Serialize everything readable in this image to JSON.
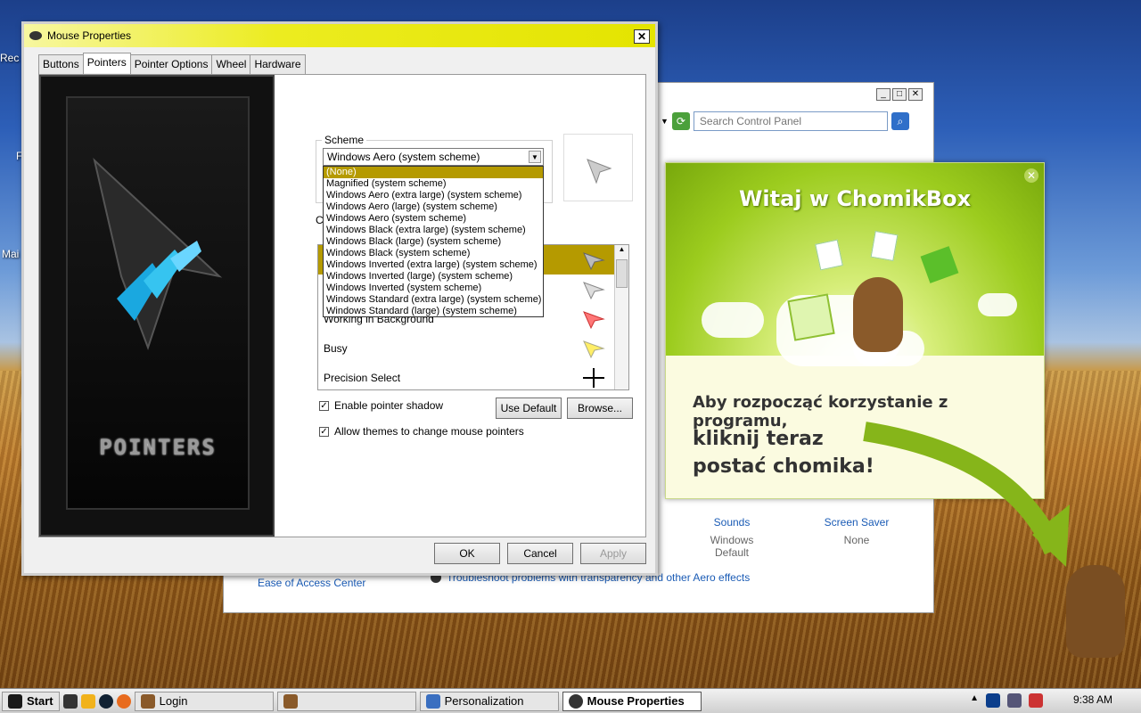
{
  "desktop": {
    "icon_labels": [
      "Rec",
      "F",
      "Mai"
    ]
  },
  "control_panel": {
    "search_placeholder": "Search Control Panel",
    "sounds_label": "Sounds",
    "sounds_value": "Windows Default",
    "screensaver_label": "Screen Saver",
    "screensaver_value": "None",
    "ease_link": "Ease of Access Center",
    "aero_link": "Troubleshoot problems with transparency and other Aero effects"
  },
  "mouse_properties": {
    "title": "Mouse Properties",
    "tabs": [
      "Buttons",
      "Pointers",
      "Pointer Options",
      "Wheel",
      "Hardware"
    ],
    "active_tab": "Pointers",
    "preview_brand": "POINTERS",
    "scheme_label": "Scheme",
    "scheme_selected": "Windows Aero (system scheme)",
    "scheme_options": [
      "(None)",
      "Magnified (system scheme)",
      "Windows Aero (extra large) (system scheme)",
      "Windows Aero (large) (system scheme)",
      "Windows Aero (system scheme)",
      "Windows Black (extra large) (system scheme)",
      "Windows Black (large) (system scheme)",
      "Windows Black (system scheme)",
      "Windows Inverted (extra large) (system scheme)",
      "Windows Inverted (large) (system scheme)",
      "Windows Inverted (system scheme)",
      "Windows Standard (extra large) (system scheme)",
      "Windows Standard (large) (system scheme)"
    ],
    "customize_label": "Cu",
    "cursors": [
      "",
      "",
      "Working in Background",
      "Busy",
      "Precision Select"
    ],
    "enable_shadow": "Enable pointer shadow",
    "allow_themes": "Allow themes to change mouse pointers",
    "use_default": "Use Default",
    "browse": "Browse...",
    "ok": "OK",
    "cancel": "Cancel",
    "apply": "Apply"
  },
  "chomikbox": {
    "title": "Witaj w ChomikBox",
    "line1": "Aby rozpocząć korzystanie z programu,",
    "line2": "kliknij teraz",
    "line3": "postać chomika!"
  },
  "taskbar": {
    "start": "Start",
    "items": [
      "Login",
      "",
      "Personalization",
      "Mouse Properties"
    ],
    "clock": "9:38 AM"
  },
  "colors": {
    "selection": "#b59a00",
    "title_yellow": "#ecec20",
    "chomik_green": "#9ccc1e"
  }
}
